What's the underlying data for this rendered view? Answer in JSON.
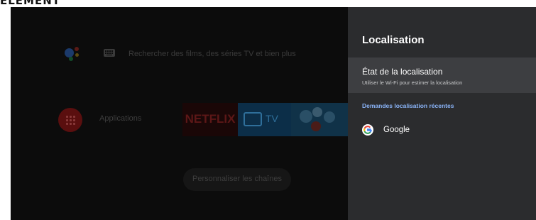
{
  "page_heading": "ÉLÉMENT",
  "home": {
    "search_hint": "Rechercher des films, des séries TV et bien plus",
    "apps_label": "Applications",
    "netflix_label": "NETFLIX",
    "tv_label": "TV",
    "customize_label": "Personnaliser les chaînes"
  },
  "panel": {
    "title": "Localisation",
    "status_title": "État de la localisation",
    "status_subtitle": "Utiliser le Wi-Fi pour estimer la localisation",
    "section_header": "Demandes localisation récentes",
    "apps": [
      {
        "label": "Google",
        "icon": "google-g-icon"
      }
    ]
  },
  "colors": {
    "panel_bg": "#2b2c2e",
    "selected_row_bg": "#3d3e41",
    "accent": "#8ab4f8",
    "netflix_red": "#e50914"
  }
}
